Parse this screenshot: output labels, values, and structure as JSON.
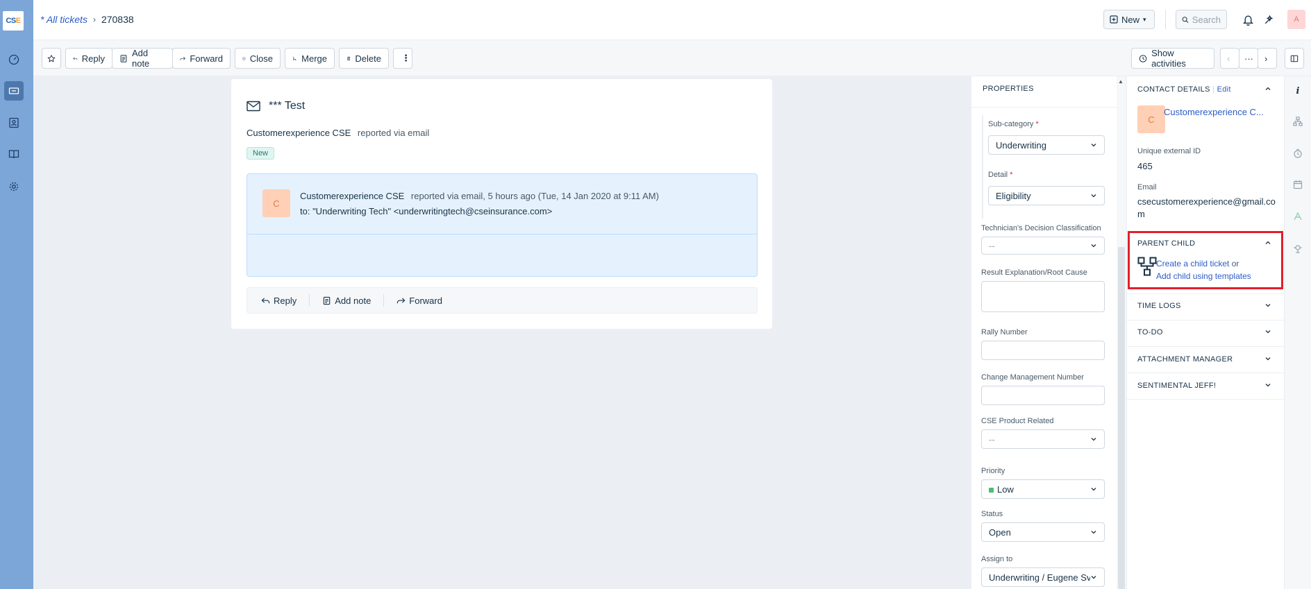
{
  "brand": {
    "logo_text_a": "CS",
    "logo_text_b": "E"
  },
  "breadcrumb": {
    "list": "* All tickets",
    "ticket_id": "270838"
  },
  "header": {
    "new_label": "New",
    "search_placeholder": "Search",
    "avatar_letter": "A"
  },
  "toolbar": {
    "reply": "Reply",
    "add_note": "Add note",
    "forward": "Forward",
    "close": "Close",
    "merge": "Merge",
    "delete": "Delete",
    "show_activities": "Show activities"
  },
  "ticket": {
    "subject": "*** Test",
    "reporter_name": "Customerexperience CSE",
    "reported_via": "reported via email",
    "status_badge": "New",
    "message": {
      "avatar_letter": "C",
      "from_name": "Customerexperience CSE",
      "meta": "reported via email, 5 hours ago (Tue, 14 Jan 2020 at 9:11 AM)",
      "to": "to: \"Underwriting Tech\" <underwritingtech@cseinsurance.com>"
    },
    "actions": {
      "reply": "Reply",
      "add_note": "Add note",
      "forward": "Forward"
    }
  },
  "properties": {
    "title": "PROPERTIES",
    "sub_category": {
      "label": "Sub-category",
      "value": "Underwriting"
    },
    "detail": {
      "label": "Detail",
      "value": "Eligibility"
    },
    "tech_decision": {
      "label": "Technician's Decision Classification",
      "value": "--"
    },
    "result_explanation": {
      "label": "Result Explanation/Root Cause",
      "value": ""
    },
    "rally_number": {
      "label": "Rally Number",
      "value": ""
    },
    "change_mgmt": {
      "label": "Change Management Number",
      "value": ""
    },
    "cse_product": {
      "label": "CSE Product Related",
      "value": "--"
    },
    "priority": {
      "label": "Priority",
      "value": "Low",
      "color": "#4dbd74"
    },
    "status": {
      "label": "Status",
      "value": "Open"
    },
    "assign_to": {
      "label": "Assign to",
      "value": "Underwriting / Eugene Sv"
    }
  },
  "sidebar": {
    "contact_details": {
      "title": "CONTACT DETAILS",
      "edit": "Edit",
      "avatar_letter": "C",
      "name": "Customerexperience C...",
      "ext_id_label": "Unique external ID",
      "ext_id": "465",
      "email_label": "Email",
      "email": "csecustomerexperience@gmail.com"
    },
    "parent_child": {
      "title": "PARENT CHILD",
      "create_child": "Create a child ticket",
      "or": "or",
      "add_child_templates": "Add child using templates"
    },
    "time_logs": "TIME LOGS",
    "todo": "TO-DO",
    "attachment_manager": "ATTACHMENT MANAGER",
    "sentimental": "SENTIMENTAL JEFF!"
  },
  "colors": {
    "nav_bg": "#7da6d8",
    "link": "#2c5cc5",
    "highlight": "#e0202a",
    "message_bg": "#e5f2fd"
  }
}
